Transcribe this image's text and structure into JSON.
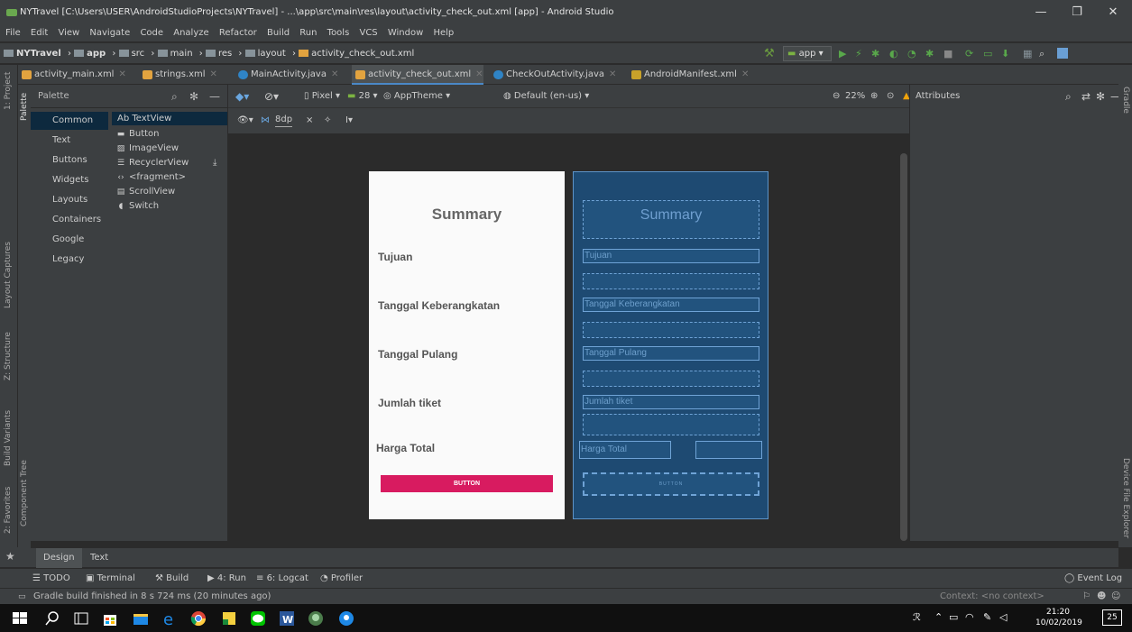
{
  "window": {
    "title": "NYTravel [C:\\Users\\USER\\AndroidStudioProjects\\NYTravel] - ...\\app\\src\\main\\res\\layout\\activity_check_out.xml [app] - Android Studio",
    "minimize": "—",
    "maximize": "❐",
    "close": "✕"
  },
  "menu": [
    "File",
    "Edit",
    "View",
    "Navigate",
    "Code",
    "Analyze",
    "Refactor",
    "Build",
    "Run",
    "Tools",
    "VCS",
    "Window",
    "Help"
  ],
  "breadcrumb": [
    "NYTravel",
    "app",
    "src",
    "main",
    "res",
    "layout",
    "activity_check_out.xml"
  ],
  "run_config": "app",
  "tabs": [
    {
      "label": "activity_main.xml",
      "color": "#e2a33f"
    },
    {
      "label": "strings.xml",
      "color": "#e2a33f"
    },
    {
      "label": "MainActivity.java",
      "color": "#2f84c6"
    },
    {
      "label": "activity_check_out.xml",
      "color": "#e2a33f"
    },
    {
      "label": "CheckOutActivity.java",
      "color": "#2f84c6"
    },
    {
      "label": "AndroidManifest.xml",
      "color": "#c9a22a"
    }
  ],
  "left_tool_windows": [
    "1: Project",
    "Layout Captures",
    "Z: Structure",
    "Build Variants",
    "2: Favorites"
  ],
  "palette_strip_label": "Palette",
  "component_tree_label": "Component Tree",
  "palette": {
    "title": "Palette",
    "categories": [
      "Common",
      "Text",
      "Buttons",
      "Widgets",
      "Layouts",
      "Containers",
      "Google",
      "Legacy"
    ],
    "items": [
      "Ab TextView",
      "Button",
      "ImageView",
      "RecyclerView",
      "<fragment>",
      "ScrollView",
      "Switch"
    ]
  },
  "design_toolbar": {
    "device": "Pixel",
    "api": "28",
    "theme": "AppTheme",
    "locale": "Default (en-us)",
    "zoom": "22%",
    "margin": "8dp"
  },
  "attributes_title": "Attributes",
  "right_tool_windows": [
    "Gradle",
    "Device File Explorer"
  ],
  "preview": {
    "title": "Summary",
    "labels": [
      "Tujuan",
      "Tanggal Keberangkatan",
      "Tanggal Pulang",
      "Jumlah tiket",
      "Harga Total"
    ],
    "button": "BUTTON"
  },
  "blueprint": {
    "title": "Summary",
    "labels": [
      "Tujuan",
      "Tanggal Keberangkatan",
      "Tanggal Pulang",
      "Jumlah tiket",
      "Harga Total"
    ],
    "button": "BUTTON"
  },
  "editor_tabs": [
    "Design",
    "Text"
  ],
  "bottom_tools": [
    "TODO",
    "Terminal",
    "Build",
    "4: Run",
    "6: Logcat",
    "Profiler"
  ],
  "event_log": "Event Log",
  "status_message": "Gradle build finished in 8 s 724 ms (20 minutes ago)",
  "context": "Context: <no context>",
  "taskbar": {
    "time": "21:20",
    "date": "10/02/2019",
    "notifications": "25"
  }
}
